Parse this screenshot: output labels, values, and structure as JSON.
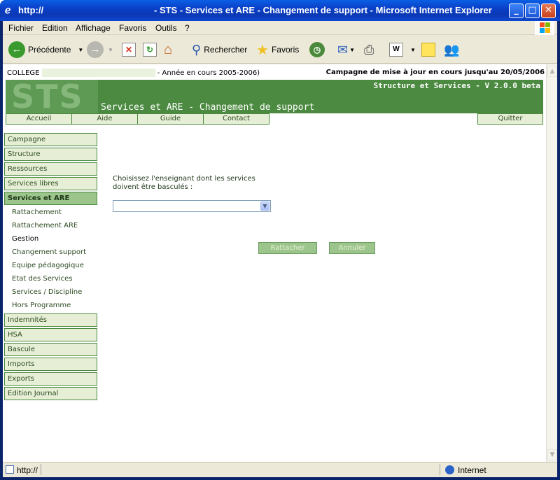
{
  "window": {
    "url_title": "http://",
    "title": "- STS - Services et ARE - Changement de support - Microsoft Internet Explorer"
  },
  "menu": [
    "Fichier",
    "Edition",
    "Affichage",
    "Favoris",
    "Outils",
    "?"
  ],
  "toolbar": {
    "back_label": "Précédente",
    "search_label": "Rechercher",
    "favorites_label": "Favoris"
  },
  "header": {
    "college_label": "COLLEGE",
    "year_label": "- Année en cours 2005-2006)",
    "campaign_label": "Campagne de mise à jour en cours jusqu'au 20/05/2006",
    "version": "Structure et Services - V 2.0.0 beta",
    "logo_text": "STS",
    "page_title": "Services et ARE - Changement de support"
  },
  "nav": [
    "Accueil",
    "Aide",
    "Guide",
    "Contact",
    "Quitter"
  ],
  "sidebar": {
    "top_items": [
      "Campagne",
      "Structure",
      "Ressources",
      "Services libres"
    ],
    "active_item": "Services et ARE",
    "sub_items": [
      "Rattachement",
      "Rattachement ARE",
      "Gestion",
      "Changement support",
      "Equipe pédagogique",
      "Etat des Services",
      "Services / Discipline",
      "Hors Programme"
    ],
    "bottom_items": [
      "Indemnités",
      "HSA",
      "Bascule",
      "Imports",
      "Exports",
      "Edition Journal"
    ]
  },
  "main": {
    "prompt_line1": "Choisissez l'enseignant dont les services",
    "prompt_line2": "doivent être basculés :",
    "teacher_select_value": "",
    "attach_button": "Rattacher",
    "cancel_button": "Annuler"
  },
  "status": {
    "url": "http://",
    "zone": "Internet"
  },
  "colors": {
    "banner_green": "#4b8a40",
    "tab_green": "#e6efd5",
    "active_green": "#9cc58c"
  }
}
